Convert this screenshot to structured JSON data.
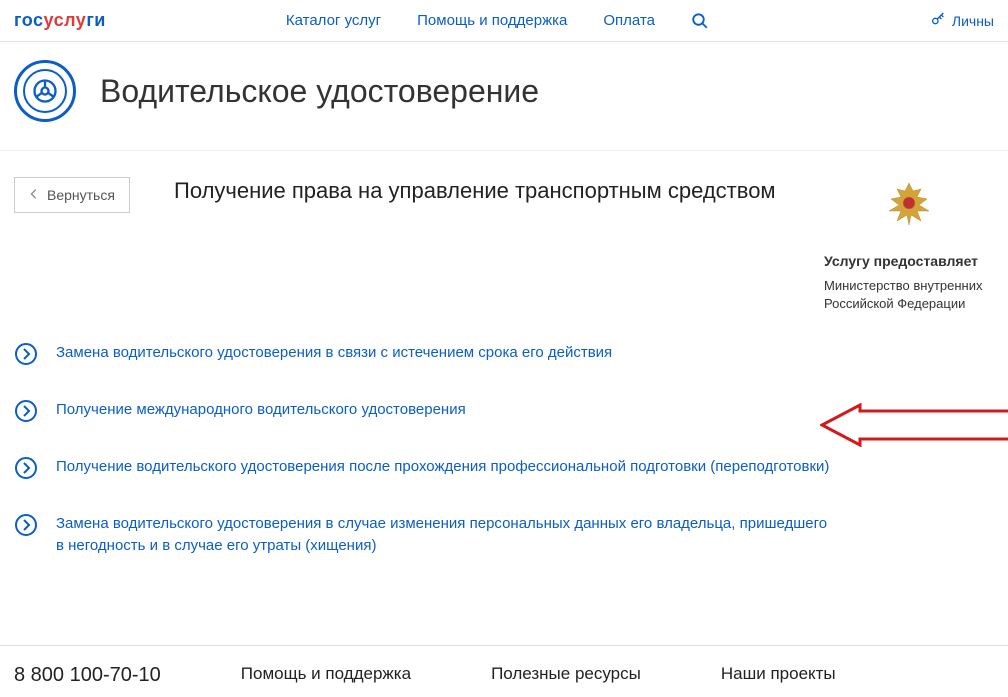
{
  "header": {
    "logo_blue1": "гос",
    "logo_red": "услу",
    "logo_blue2": "ги",
    "nav": {
      "catalog": "Каталог услуг",
      "help": "Помощь и поддержка",
      "payment": "Оплата"
    },
    "personal": "Личны"
  },
  "page": {
    "title": "Водительское удостоверение",
    "back": "Вернуться",
    "subheading": "Получение права на управление транспортным средством"
  },
  "provider": {
    "label": "Услугу предоставляет",
    "name": "Министерство внутренних Российской Федерации"
  },
  "services": [
    "Замена водительского удостоверения в связи с истечением срока его действия",
    "Получение международного водительского удостоверения",
    "Получение водительского удостоверения после прохождения профессиональной подготовки (переподготовки)",
    "Замена водительского удостоверения в случае изменения персональных данных его владельца, пришедшего в негодность и в случае его утраты (хищения)"
  ],
  "footer": {
    "phone": "8 800 100-70-10",
    "cols": [
      "Помощь и поддержка",
      "Полезные ресурсы",
      "Наши проекты"
    ]
  }
}
